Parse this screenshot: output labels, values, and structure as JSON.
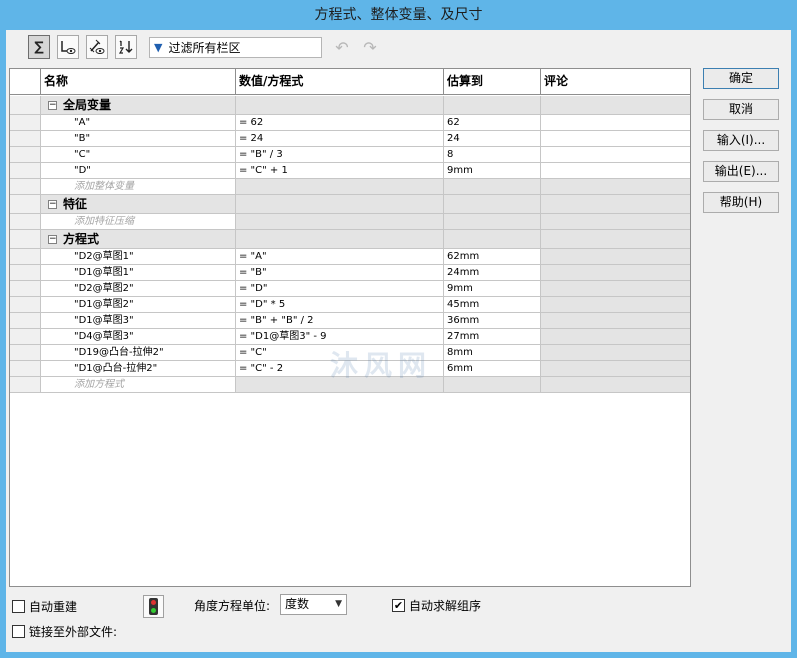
{
  "window": {
    "title": "方程式、整体变量、及尺寸"
  },
  "toolbar": {
    "sum_icon": "∑",
    "filter_placeholder": "过滤所有栏区"
  },
  "grid": {
    "headers": {
      "name": "名称",
      "value": "数值/方程式",
      "evaluates": "估算到",
      "comment": "评论"
    },
    "globals": {
      "title": "全局变量",
      "rows": [
        {
          "name": "\"A\"",
          "value": "= 62",
          "eval": "62"
        },
        {
          "name": "\"B\"",
          "value": "= 24",
          "eval": "24"
        },
        {
          "name": "\"C\"",
          "value": "= \"B\" / 3",
          "eval": "8"
        },
        {
          "name": "\"D\"",
          "value": "= \"C\" + 1",
          "eval": "9mm"
        }
      ],
      "add": "添加整体变量"
    },
    "features": {
      "title": "特征",
      "add": "添加特征压缩"
    },
    "equations": {
      "title": "方程式",
      "rows": [
        {
          "name": "\"D2@草图1\"",
          "value": "= \"A\"",
          "eval": "62mm"
        },
        {
          "name": "\"D1@草图1\"",
          "value": "= \"B\"",
          "eval": "24mm"
        },
        {
          "name": "\"D2@草图2\"",
          "value": "= \"D\"",
          "eval": "9mm"
        },
        {
          "name": "\"D1@草图2\"",
          "value": "= \"D\" * 5",
          "eval": "45mm"
        },
        {
          "name": "\"D1@草图3\"",
          "value": "= \"B\" + \"B\" / 2",
          "eval": "36mm"
        },
        {
          "name": "\"D4@草图3\"",
          "value": "= \"D1@草图3\" - 9",
          "eval": "27mm"
        },
        {
          "name": "\"D19@凸台-拉伸2\"",
          "value": "= \"C\"",
          "eval": "8mm"
        },
        {
          "name": "\"D1@凸台-拉伸2\"",
          "value": "= \"C\" - 2",
          "eval": "6mm"
        }
      ],
      "add": "添加方程式"
    }
  },
  "buttons": {
    "ok": "确定",
    "cancel": "取消",
    "import": "输入(I)...",
    "export": "输出(E)...",
    "help": "帮助(H)"
  },
  "bottom": {
    "auto_rebuild": "自动重建",
    "auto_rebuild_checked": false,
    "link_external": "链接至外部文件:",
    "link_external_checked": false,
    "angle_units_label": "角度方程单位:",
    "angle_units_value": "度数",
    "auto_solve": "自动求解组序",
    "auto_solve_checked": true
  },
  "watermark": "沐风网"
}
